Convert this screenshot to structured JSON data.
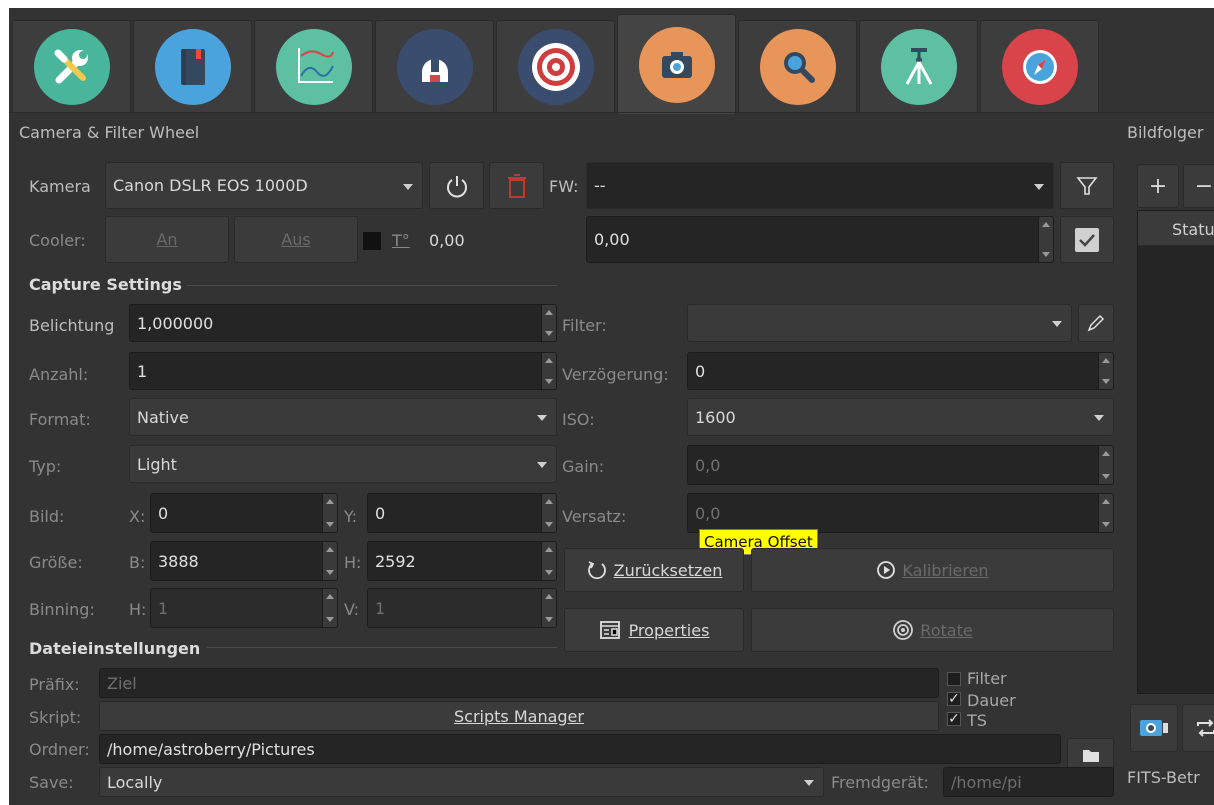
{
  "tabs": [
    {
      "name": "setup",
      "icon": "wrench-screwdriver-icon",
      "color": "#49b59b"
    },
    {
      "name": "scheduler",
      "icon": "notebook-icon",
      "color": "#4aa3dd"
    },
    {
      "name": "analyze",
      "icon": "chart-icon",
      "color": "#5dc0a0"
    },
    {
      "name": "observatory",
      "icon": "dome-icon",
      "color": "#3a4d6f"
    },
    {
      "name": "align",
      "icon": "target-icon",
      "color": "#cf3d3f"
    },
    {
      "name": "capture",
      "icon": "camera-icon",
      "color": "#e8955a"
    },
    {
      "name": "focus",
      "icon": "magnifier-icon",
      "color": "#e8955a"
    },
    {
      "name": "mount",
      "icon": "tripod-icon",
      "color": "#5dc0a0"
    },
    {
      "name": "guide",
      "icon": "compass-icon",
      "color": "#d9434a"
    }
  ],
  "header": {
    "title": "Camera & Filter Wheel",
    "right_title": "Bildfolger"
  },
  "camera": {
    "label": "Kamera",
    "value": "Canon DSLR EOS 1000D",
    "fw_label": "FW:",
    "fw_value": "--"
  },
  "cooler": {
    "label": "Cooler:",
    "on": "An",
    "off": "Aus",
    "temp_label": "T°",
    "temp_value": "0,00",
    "setpoint": "0,00"
  },
  "capture": {
    "title": "Capture Settings",
    "exposure_label": "Belichtung",
    "exposure": "1,000000",
    "count_label": "Anzahl:",
    "count": "1",
    "format_label": "Format:",
    "format": "Native",
    "type_label": "Typ:",
    "type": "Light",
    "frame_label": "Bild:",
    "x_label": "X:",
    "x": "0",
    "y_label": "Y:",
    "y": "0",
    "size_label": "Größe:",
    "w_label": "B:",
    "w": "3888",
    "h_label": "H:",
    "h": "2592",
    "bin_label": "Binning:",
    "binh_label": "H:",
    "binh": "1",
    "binv_label": "V:",
    "binv": "1",
    "filter_label": "Filter:",
    "filter": "",
    "delay_label": "Verzögerung:",
    "delay": "0",
    "iso_label": "ISO:",
    "iso": "1600",
    "gain_label": "Gain:",
    "gain": "0,0",
    "offset_label": "Versatz:",
    "offset": "0,0",
    "tooltip": "Camera Offset",
    "reset": "Zurücksetzen",
    "calibrate": "Kalibrieren",
    "properties": "Properties",
    "rotate": "Rotate"
  },
  "file": {
    "title": "Dateieinstellungen",
    "prefix_label": "Präfix:",
    "prefix_placeholder": "Ziel",
    "script_label": "Skript:",
    "scripts_manager": "Scripts Manager",
    "folder_label": "Ordner:",
    "folder": "/home/astroberry/Pictures",
    "save_label": "Save:",
    "save": "Locally",
    "remote_label": "Fremdgerät:",
    "remote_placeholder": "/home/pi",
    "cb_filter": "Filter",
    "cb_duration": "Dauer",
    "cb_ts": "TS"
  },
  "queue": {
    "add": "+",
    "remove": "−",
    "status_col": "Statu",
    "fits_label": "FITS-Betr"
  }
}
